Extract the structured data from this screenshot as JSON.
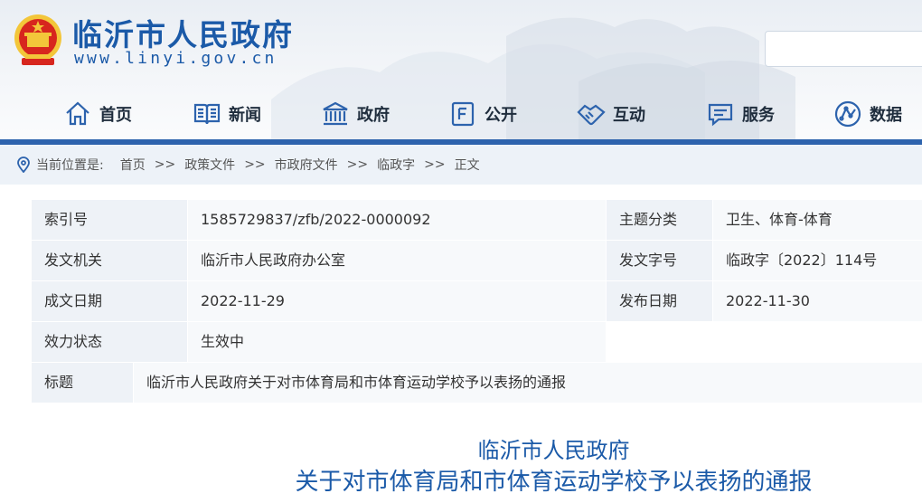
{
  "site": {
    "title": "临沂市人民政府",
    "url": "www.linyi.gov.cn",
    "search_placeholder": ""
  },
  "nav": {
    "items": [
      {
        "label": "首页",
        "icon": "home-icon"
      },
      {
        "label": "新闻",
        "icon": "news-book-icon"
      },
      {
        "label": "政府",
        "icon": "government-building-icon"
      },
      {
        "label": "公开",
        "icon": "public-document-icon"
      },
      {
        "label": "互动",
        "icon": "handshake-icon"
      },
      {
        "label": "服务",
        "icon": "service-chat-icon"
      },
      {
        "label": "数据",
        "icon": "data-network-icon"
      }
    ]
  },
  "breadcrumb": {
    "label": "当前位置是:",
    "items": [
      "首页",
      "政策文件",
      "市政府文件",
      "临政字",
      "正文"
    ],
    "separator": ">>"
  },
  "info": {
    "index_key": "索引号",
    "index_val": "1585729837/zfb/2022-0000092",
    "topic_key": "主题分类",
    "topic_val": "卫生、体育-体育",
    "issuer_key": "发文机关",
    "issuer_val": "临沂市人民政府办公室",
    "docno_key": "发文字号",
    "docno_val": "临政字〔2022〕114号",
    "date_key": "成文日期",
    "date_val": "2022-11-29",
    "pub_key": "发布日期",
    "pub_val": "2022-11-30",
    "status_key": "效力状态",
    "status_val": "生效中",
    "title_key": "标题",
    "title_val": "临沂市人民政府关于对市体育局和市体育运动学校予以表扬的通报"
  },
  "document": {
    "title_line1": "临沂市人民政府",
    "title_line2": "关于对市体育局和市体育运动学校予以表扬的通报"
  },
  "colors": {
    "brand_blue": "#1b5aa8",
    "nav_bar": "#2d63ad",
    "breadcrumb_bg": "#edf2f8",
    "emblem_red": "#d7261e",
    "emblem_gold": "#f3c63a"
  }
}
